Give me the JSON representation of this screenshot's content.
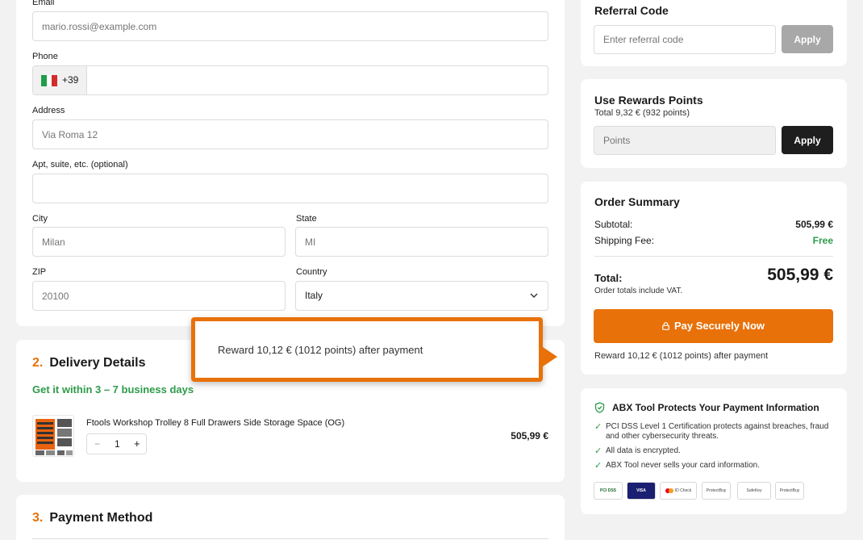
{
  "contact": {
    "email_label": "Email",
    "email_placeholder": "mario.rossi@example.com",
    "phone_label": "Phone",
    "phone_prefix": "+39",
    "address_label": "Address",
    "address_placeholder": "Via Roma 12",
    "apt_label": "Apt, suite, etc. (optional)",
    "city_label": "City",
    "city_placeholder": "Milan",
    "state_label": "State",
    "state_placeholder": "MI",
    "zip_label": "ZIP",
    "zip_placeholder": "20100",
    "country_label": "Country",
    "country_value": "Italy"
  },
  "delivery": {
    "number": "2.",
    "title": "Delivery Details",
    "estimate": "Get it within 3 – 7 business days",
    "item_name": "Ftools Workshop Trolley 8 Full Drawers Side Storage Space (OG)",
    "item_qty": "1",
    "item_price": "505,99 €",
    "minus": "−",
    "plus": "+"
  },
  "payment": {
    "number": "3.",
    "title": "Payment Method"
  },
  "referral": {
    "title": "Referral Code",
    "placeholder": "Enter referral code",
    "apply": "Apply"
  },
  "rewards": {
    "title": "Use Rewards Points",
    "total": "Total 9,32 € (932 points)",
    "placeholder": "Points",
    "apply": "Apply"
  },
  "summary": {
    "title": "Order Summary",
    "subtotal_label": "Subtotal:",
    "subtotal_value": "505,99 €",
    "shipping_label": "Shipping Fee:",
    "shipping_value": "Free",
    "total_label": "Total:",
    "total_value": "505,99 €",
    "vat_note": "Order totals include VAT.",
    "pay_button": "Pay Securely Now",
    "reward_note": "Reward 10,12 € (1012 points) after payment"
  },
  "protect": {
    "title": "ABX Tool Protects Your Payment Information",
    "items": [
      "PCI DSS Level 1 Certification protects against breaches, fraud and other cybersecurity threats.",
      "All data is encrypted.",
      "ABX Tool never sells your card information."
    ],
    "check_mark": "✓",
    "badges": [
      "PCI DSS",
      "VISA",
      "ID Check",
      "ProtectBuy",
      "SafeKey",
      "ProtectBuy"
    ]
  },
  "tooltip": {
    "text": "Reward 10,12 € (1012 points) after payment"
  },
  "colors": {
    "accent": "#e8710a",
    "success": "#2e9b4a",
    "dark_button": "#1e1e1e",
    "disabled_button": "#a8a8a8"
  }
}
